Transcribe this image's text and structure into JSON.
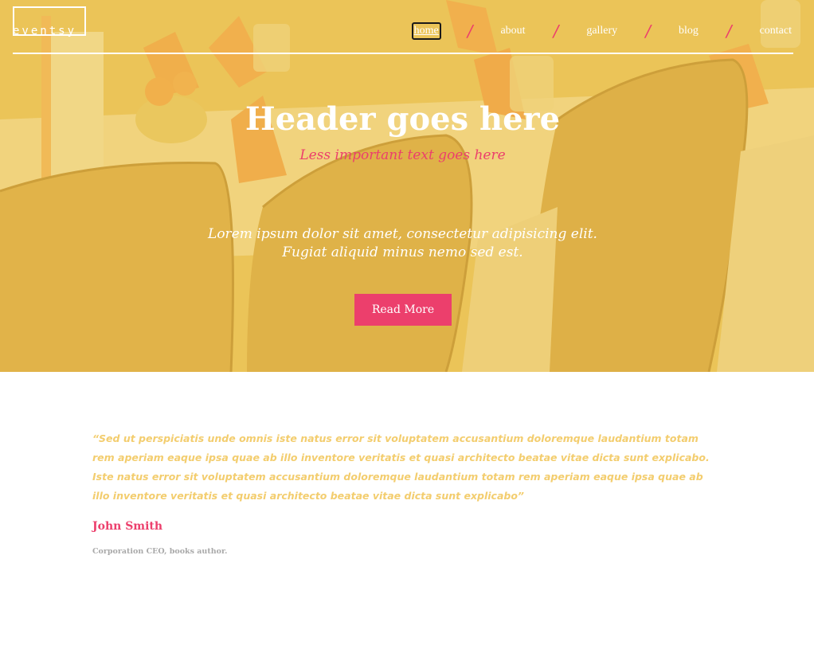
{
  "brand": {
    "logo": "eventsy"
  },
  "nav": {
    "items": [
      {
        "label": "home",
        "active": true
      },
      {
        "label": "about",
        "active": false
      },
      {
        "label": "gallery",
        "active": false
      },
      {
        "label": "blog",
        "active": false
      },
      {
        "label": "contact",
        "active": false
      }
    ],
    "separator": "/"
  },
  "hero": {
    "title": "Header goes here",
    "subtitle": "Less important text goes here",
    "body_line1": "Lorem ipsum dolor sit amet, consectetur adipisicing elit.",
    "body_line2": "Fugiat aliquid minus nemo sed est.",
    "button_label": "Read More"
  },
  "testimonial": {
    "quote": "“Sed ut perspiciatis unde omnis iste natus error sit voluptatem accusantium doloremque laudantium totam rem aperiam eaque ipsa quae ab illo inventore veritatis et quasi architecto beatae vitae dicta sunt explicabo. Iste natus error sit voluptatem accusantium doloremque laudantium totam rem aperiam eaque ipsa quae ab illo inventore veritatis et quasi architecto beatae vitae dicta sunt explicabo”",
    "author": "John Smith",
    "role": "Corporation CEO, books author."
  },
  "colors": {
    "accent": "#ec3f6c",
    "hero_overlay": "#e9c25f",
    "quote_text": "#f3cd6e",
    "muted_text": "#a9a9a9"
  }
}
